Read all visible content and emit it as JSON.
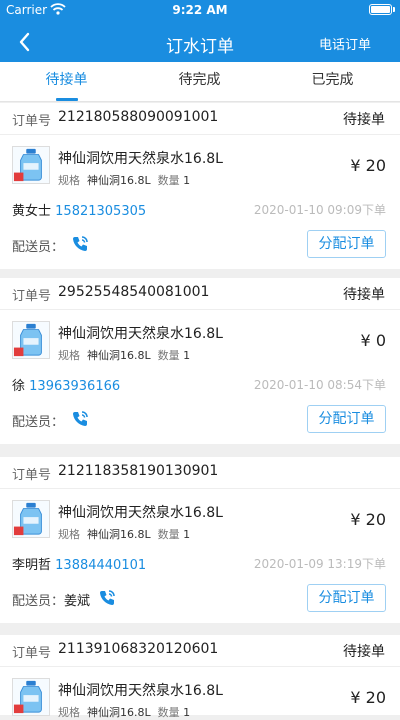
{
  "status_bar": {
    "carrier": "Carrier",
    "time": "9:22 AM"
  },
  "nav": {
    "title": "订水订单",
    "right_action": "电话订单"
  },
  "tabs": [
    "待接单",
    "待完成",
    "已完成"
  ],
  "labels": {
    "order_no": "订单号",
    "spec": "规格",
    "quantity": "数量",
    "courier": "配送员：",
    "assign_button": "分配订单"
  },
  "orders": [
    {
      "order_no": "212180588090091001",
      "state": "待接单",
      "product_name": "神仙洞饮用天然泉水16.8L",
      "spec_value": "神仙洞16.8L",
      "quantity": "1",
      "price": "¥ 20",
      "customer_name": "黄女士",
      "customer_phone": "15821305305",
      "datetime": "2020-01-10 09:09下单",
      "courier_name": "",
      "assign_label": "分配订单"
    },
    {
      "order_no": "29525548540081001",
      "state": "待接单",
      "product_name": "神仙洞饮用天然泉水16.8L",
      "spec_value": "神仙洞16.8L",
      "quantity": "1",
      "price": "¥ 0",
      "customer_name": "徐",
      "customer_phone": "13963936166",
      "datetime": "2020-01-10 08:54下单",
      "courier_name": "",
      "assign_label": "分配订单"
    },
    {
      "order_no": "212118358190130901",
      "state": "",
      "product_name": "神仙洞饮用天然泉水16.8L",
      "spec_value": "神仙洞16.8L",
      "quantity": "1",
      "price": "¥ 20",
      "customer_name": "李明哲",
      "customer_phone": "13884440101",
      "datetime": "2020-01-09 13:19下单",
      "courier_name": "姜斌",
      "assign_label": "分配订单"
    },
    {
      "order_no": "211391068320120601",
      "state": "待接单",
      "product_name": "神仙洞饮用天然泉水16.8L",
      "spec_value": "神仙洞16.8L",
      "quantity": "1",
      "price": "¥ 20"
    }
  ],
  "colors": {
    "primary": "#1a8de0",
    "background": "#efefef"
  },
  "icons": {
    "back": "chevron-left-icon",
    "phone": "phone-call-icon",
    "wifi": "wifi-icon",
    "battery": "battery-icon"
  }
}
